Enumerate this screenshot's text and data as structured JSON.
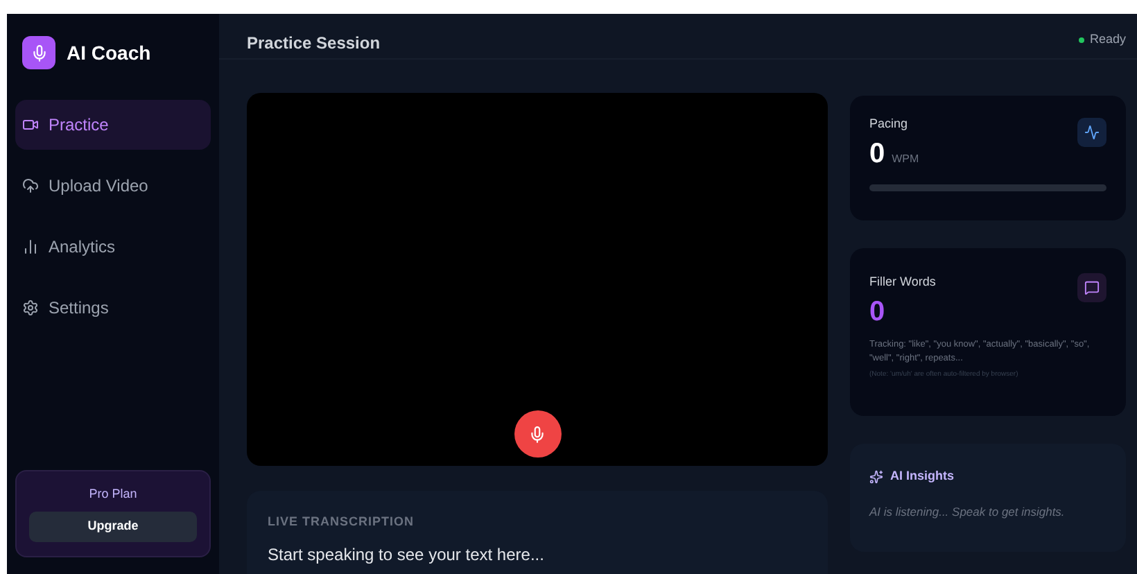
{
  "brand": {
    "title": "AI Coach"
  },
  "sidebar": {
    "items": [
      {
        "label": "Practice",
        "selected": true
      },
      {
        "label": "Upload Video",
        "selected": false
      },
      {
        "label": "Analytics",
        "selected": false
      },
      {
        "label": "Settings",
        "selected": false
      }
    ],
    "plan": {
      "label": "Pro Plan",
      "button": "Upgrade"
    }
  },
  "header": {
    "title": "Practice Session",
    "status": "Ready"
  },
  "transcription": {
    "title": "LIVE TRANSCRIPTION",
    "text": "Start speaking to see your text here..."
  },
  "pacing": {
    "title": "Pacing",
    "value": "0",
    "unit": "WPM",
    "level": 0
  },
  "filler": {
    "title": "Filler Words",
    "value": "0",
    "tracking": "Tracking: \"like\", \"you know\", \"actually\", \"basically\", \"so\", \"well\", \"right\", repeats...",
    "note": "(Note: 'um/uh' are often auto-filtered by browser)"
  },
  "insights": {
    "title": "AI Insights",
    "text": "AI is listening... Speak to get insights."
  }
}
